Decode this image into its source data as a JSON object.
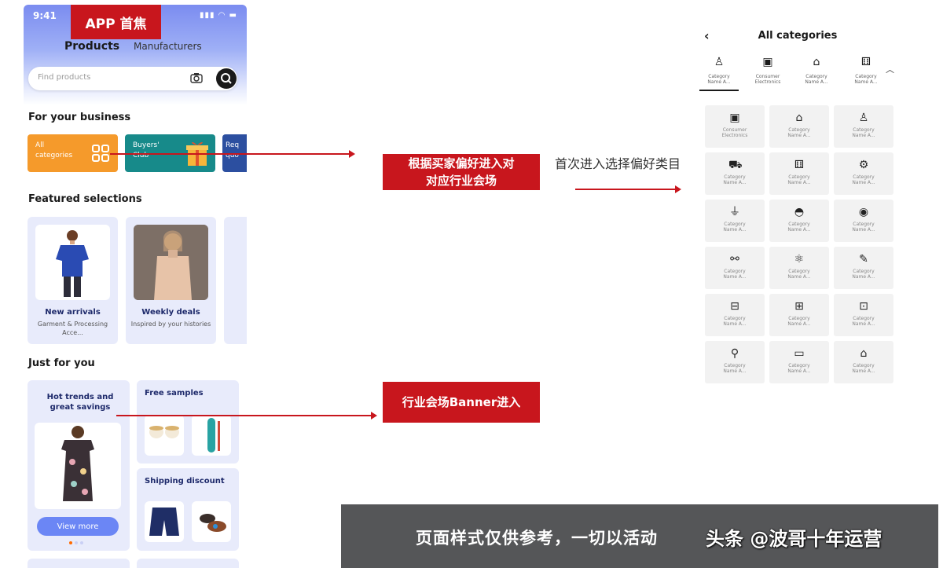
{
  "phone": {
    "status_time": "9:41",
    "app_focus_label": "APP 首焦",
    "segment_products": "Products",
    "segment_manufacturers": "Manufacturers",
    "search_placeholder": "Find products",
    "for_business_title": "For your business",
    "business_cards": [
      {
        "label": "All\ncategories"
      },
      {
        "label": "Buyers'\nClub"
      },
      {
        "label": "Req\nquo"
      }
    ],
    "featured_title": "Featured selections",
    "featured": [
      {
        "title": "New arrivals",
        "sub": "Garment & Processing Acce..."
      },
      {
        "title": "Weekly deals",
        "sub": "Inspired by your histories"
      }
    ],
    "just_for_you_title": "Just for you",
    "jfy_hot_title": "Hot trends and great savings",
    "jfy_free_samples": "Free samples",
    "jfy_shipping": "Shipping discount",
    "view_more": "View more",
    "accent_color": "#c8161d",
    "button_color": "#6b86f5"
  },
  "annotations": {
    "box1": "根据买家偏好进入对\n对应行业会场",
    "first_entry_note": "首次进入选择偏好类目",
    "box2": "行业会场Banner进入"
  },
  "categories_panel": {
    "title": "All categories",
    "tabs": [
      {
        "icon": "dress-icon",
        "glyph": "♙",
        "label": "Category\nName A..."
      },
      {
        "icon": "tablet-icon",
        "glyph": "▣",
        "label": "Consumer\nElectronics"
      },
      {
        "icon": "house-icon",
        "glyph": "⌂",
        "label": "Category\nName A..."
      },
      {
        "icon": "gift-icon",
        "glyph": "⚅",
        "label": "Category\nName A..."
      }
    ],
    "grid": [
      {
        "icon": "tablet-icon",
        "glyph": "▣",
        "label": "Consumer\nElectronics"
      },
      {
        "icon": "house-icon",
        "glyph": "⌂",
        "label": "Category\nName A..."
      },
      {
        "icon": "dress-icon",
        "glyph": "♙",
        "label": "Category\nName A..."
      },
      {
        "icon": "car-icon",
        "glyph": "⛟",
        "label": "Category\nName A..."
      },
      {
        "icon": "baby-clothes-icon",
        "glyph": "⚅",
        "label": "Category\nName A..."
      },
      {
        "icon": "chip-icon",
        "glyph": "⚙",
        "label": "Category\nName A..."
      },
      {
        "icon": "plug-icon",
        "glyph": "⏚",
        "label": "Category\nName A..."
      },
      {
        "icon": "helmet-icon",
        "glyph": "◓",
        "label": "Category\nName A..."
      },
      {
        "icon": "fabric-icon",
        "glyph": "◉",
        "label": "Category\nName A..."
      },
      {
        "icon": "dumbbell-icon",
        "glyph": "⚯",
        "label": "Category\nName A..."
      },
      {
        "icon": "molecule-icon",
        "glyph": "⚛",
        "label": "Category\nName A..."
      },
      {
        "icon": "tools-icon",
        "glyph": "✎",
        "label": "Category\nName A..."
      },
      {
        "icon": "toolbox-icon",
        "glyph": "⊟",
        "label": "Category\nName A..."
      },
      {
        "icon": "gift-box-icon",
        "glyph": "⊞",
        "label": "Category\nName A..."
      },
      {
        "icon": "package-icon",
        "glyph": "⊡",
        "label": "Category\nName A..."
      },
      {
        "icon": "location-pin-icon",
        "glyph": "⚲",
        "label": "Category\nName A..."
      },
      {
        "icon": "monitor-icon",
        "glyph": "▭",
        "label": "Category\nName A..."
      },
      {
        "icon": "house-icon",
        "glyph": "⌂",
        "label": "Category\nName A..."
      }
    ]
  },
  "disclaimer": "页面样式仅供参考，一切以活动",
  "watermark": "头条 @波哥十年运营"
}
